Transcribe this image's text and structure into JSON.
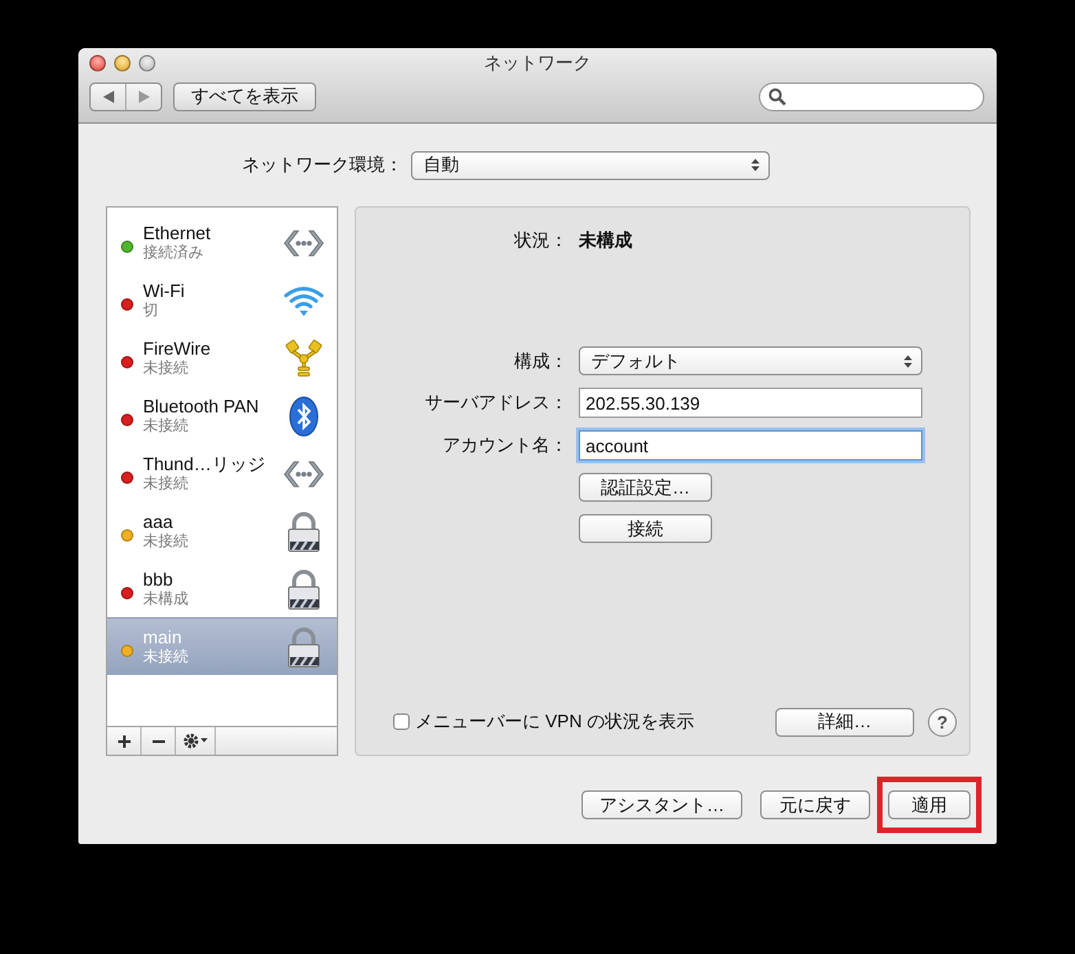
{
  "window": {
    "title": "ネットワーク"
  },
  "toolbar": {
    "show_all": "すべてを表示"
  },
  "location": {
    "label": "ネットワーク環境：",
    "value": "自動"
  },
  "services": [
    {
      "name": "Ethernet",
      "status": "接続済み",
      "color": "#4fb52d",
      "kind": "ethernet",
      "selected": false
    },
    {
      "name": "Wi-Fi",
      "status": "切",
      "color": "#d81e1e",
      "kind": "wifi",
      "selected": false
    },
    {
      "name": "FireWire",
      "status": "未接続",
      "color": "#d81e1e",
      "kind": "firewire",
      "selected": false
    },
    {
      "name": "Bluetooth PAN",
      "status": "未接続",
      "color": "#d81e1e",
      "kind": "bluetooth",
      "selected": false
    },
    {
      "name": "Thund…リッジ",
      "status": "未接続",
      "color": "#d81e1e",
      "kind": "ethernet",
      "selected": false
    },
    {
      "name": "aaa",
      "status": "未接続",
      "color": "#f0b020",
      "kind": "vpn",
      "selected": false
    },
    {
      "name": "bbb",
      "status": "未構成",
      "color": "#d81e1e",
      "kind": "vpn",
      "selected": false
    },
    {
      "name": "main",
      "status": "未接続",
      "color": "#f0b020",
      "kind": "vpn",
      "selected": true
    }
  ],
  "detail": {
    "status_label": "状況：",
    "status_value": "未構成",
    "fields": [
      {
        "kind": "popup",
        "label": "構成：",
        "value": "デフォルト",
        "focused": false
      },
      {
        "kind": "text",
        "label": "サーバアドレス：",
        "value": "202.55.30.139",
        "focused": false
      },
      {
        "kind": "text",
        "label": "アカウント名：",
        "value": "account",
        "focused": true
      }
    ],
    "buttons": [
      "認証設定…",
      "接続"
    ],
    "show_vpn": {
      "label": "メニューバーに VPN の状況を表示",
      "checked": false
    },
    "advanced": "詳細…",
    "help": "?"
  },
  "footer_buttons": [
    {
      "label": "アシスタント…",
      "highlighted": false
    },
    {
      "label": "元に戻す",
      "highlighted": false
    },
    {
      "label": "適用",
      "highlighted": true
    }
  ]
}
